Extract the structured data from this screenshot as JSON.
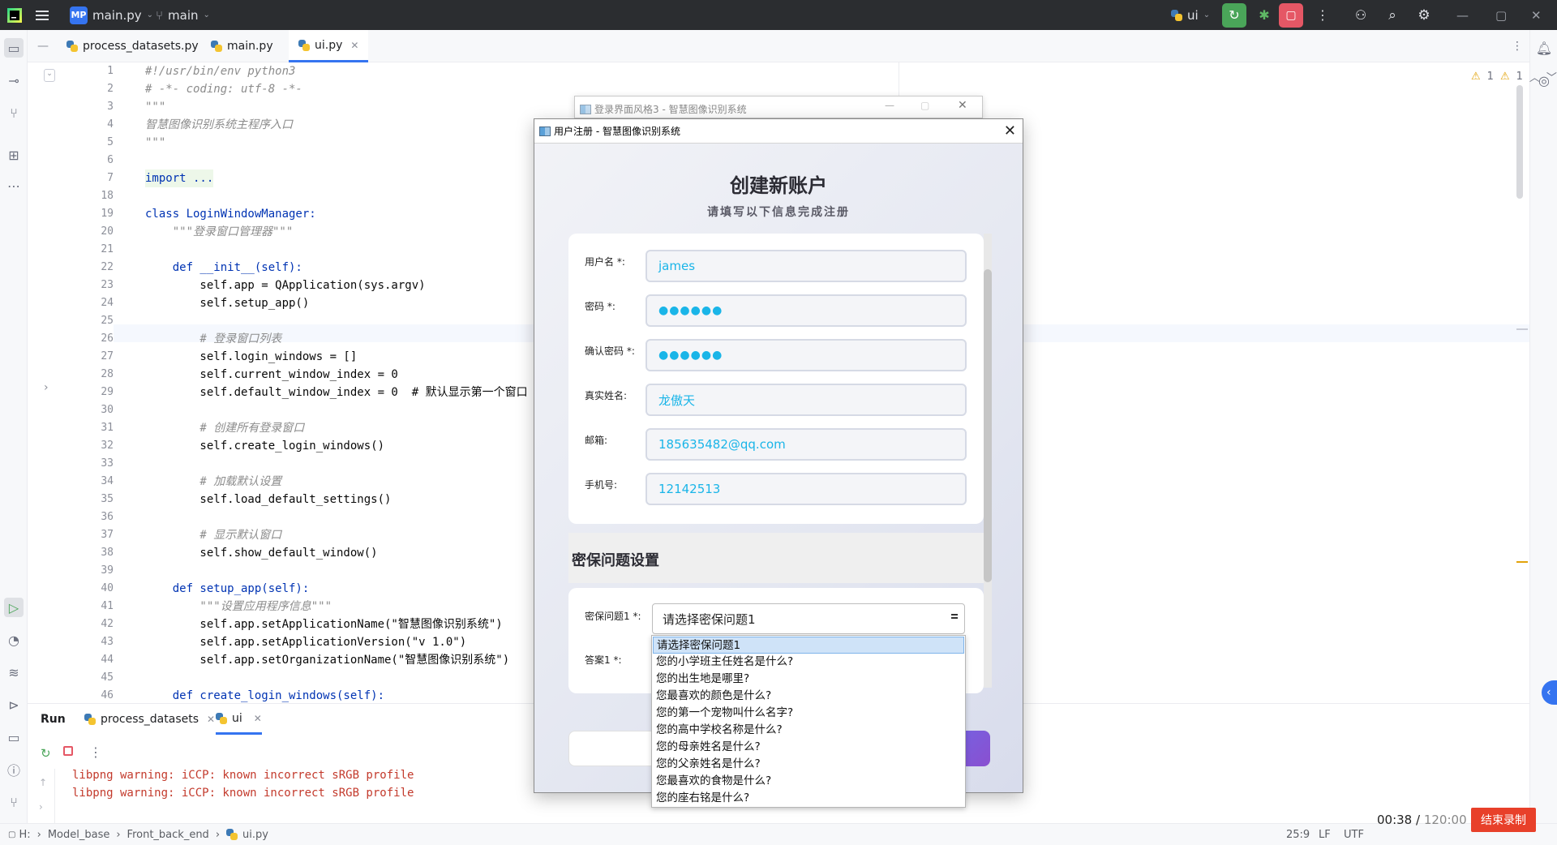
{
  "titlebar": {
    "project_badge": "MP",
    "project_name": "main.py",
    "branch": "main",
    "run_config": "ui"
  },
  "tabs": [
    "process_datasets.py",
    "main.py",
    "ui.py"
  ],
  "inspections": {
    "warn1": "1",
    "warn2": "1"
  },
  "code_lines": [
    {
      "n": "1",
      "t": "#!/usr/bin/env python3",
      "c": "cm"
    },
    {
      "n": "2",
      "t": "# -*- coding: utf-8 -*-",
      "c": "cm"
    },
    {
      "n": "3",
      "t": "\"\"\"",
      "c": "cm"
    },
    {
      "n": "4",
      "t": "智慧图像识别系统主程序入口",
      "c": "cm"
    },
    {
      "n": "5",
      "t": "\"\"\"",
      "c": "cm"
    },
    {
      "n": "6",
      "t": "",
      "c": ""
    },
    {
      "n": "7",
      "t": "import ...",
      "c": "kw"
    },
    {
      "n": "18",
      "t": "",
      "c": ""
    },
    {
      "n": "19",
      "t": "class LoginWindowManager:",
      "c": "kw"
    },
    {
      "n": "20",
      "t": "    \"\"\"登录窗口管理器\"\"\"",
      "c": "cm"
    },
    {
      "n": "21",
      "t": "",
      "c": ""
    },
    {
      "n": "22",
      "t": "    def __init__(self):",
      "c": "kw"
    },
    {
      "n": "23",
      "t": "        self.app = QApplication(sys.argv)",
      "c": ""
    },
    {
      "n": "24",
      "t": "        self.setup_app()",
      "c": ""
    },
    {
      "n": "25",
      "t": "",
      "c": ""
    },
    {
      "n": "26",
      "t": "        # 登录窗口列表",
      "c": "cm"
    },
    {
      "n": "27",
      "t": "        self.login_windows = []",
      "c": ""
    },
    {
      "n": "28",
      "t": "        self.current_window_index = 0",
      "c": ""
    },
    {
      "n": "29",
      "t": "        self.default_window_index = 0  # 默认显示第一个窗口",
      "c": ""
    },
    {
      "n": "30",
      "t": "",
      "c": ""
    },
    {
      "n": "31",
      "t": "        # 创建所有登录窗口",
      "c": "cm"
    },
    {
      "n": "32",
      "t": "        self.create_login_windows()",
      "c": ""
    },
    {
      "n": "33",
      "t": "",
      "c": ""
    },
    {
      "n": "34",
      "t": "        # 加载默认设置",
      "c": "cm"
    },
    {
      "n": "35",
      "t": "        self.load_default_settings()",
      "c": ""
    },
    {
      "n": "36",
      "t": "",
      "c": ""
    },
    {
      "n": "37",
      "t": "        # 显示默认窗口",
      "c": "cm"
    },
    {
      "n": "38",
      "t": "        self.show_default_window()",
      "c": ""
    },
    {
      "n": "39",
      "t": "",
      "c": ""
    },
    {
      "n": "40",
      "t": "    def setup_app(self):",
      "c": "kw"
    },
    {
      "n": "41",
      "t": "        \"\"\"设置应用程序信息\"\"\"",
      "c": "cm"
    },
    {
      "n": "42",
      "t": "        self.app.setApplicationName(\"智慧图像识别系统\")",
      "c": ""
    },
    {
      "n": "43",
      "t": "        self.app.setApplicationVersion(\"v 1.0\")",
      "c": ""
    },
    {
      "n": "44",
      "t": "        self.app.setOrganizationName(\"智慧图像识别系统\")",
      "c": ""
    },
    {
      "n": "45",
      "t": "",
      "c": ""
    },
    {
      "n": "46",
      "t": "    def create_login_windows(self):",
      "c": "kw"
    }
  ],
  "run_panel": {
    "label": "Run",
    "tabs": [
      "process_datasets",
      "ui"
    ],
    "output": [
      "libpng warning: iCCP: known incorrect sRGB profile",
      "libpng warning: iCCP: known incorrect sRGB profile"
    ]
  },
  "statusbar": {
    "breadcrumb": [
      "H:",
      "Model_base",
      "Front_back_end",
      "ui.py"
    ],
    "position": "25:9",
    "line_sep": "LF",
    "encoding": "UTF"
  },
  "bg_window": {
    "title": "登录界面风格3 - 智慧图像识别系统"
  },
  "dialog": {
    "title": "用户注册 - 智慧图像识别系统",
    "heading": "创建新账户",
    "subheading": "请填写以下信息完成注册",
    "fields": [
      {
        "label": "用户名 *:",
        "value": "james"
      },
      {
        "label": "密码 *:",
        "value": "●●●●●●"
      },
      {
        "label": "确认密码 *:",
        "value": "●●●●●●"
      },
      {
        "label": "真实姓名:",
        "value": "龙傲天"
      },
      {
        "label": "邮箱:",
        "value": "185635482@qq.com"
      },
      {
        "label": "手机号:",
        "value": "12142513"
      }
    ],
    "security_heading": "密保问题设置",
    "q1_label": "密保问题1 *:",
    "q1_value": "请选择密保问题1",
    "a1_label": "答案1 *:"
  },
  "dropdown_options": [
    "请选择密保问题1",
    "您的小学班主任姓名是什么?",
    "您的出生地是哪里?",
    "您最喜欢的颜色是什么?",
    "您的第一个宠物叫什么名字?",
    "您的高中学校名称是什么?",
    "您的母亲姓名是什么?",
    "您的父亲姓名是什么?",
    "您最喜欢的食物是什么?",
    "您的座右铭是什么?"
  ],
  "recording": {
    "elapsed": "00:38",
    "total": "120:00",
    "stop_label": "结束录制"
  },
  "colors": {
    "accent": "#3574f0",
    "input_text": "#1ab5e8",
    "record_button": "#e8402a"
  }
}
